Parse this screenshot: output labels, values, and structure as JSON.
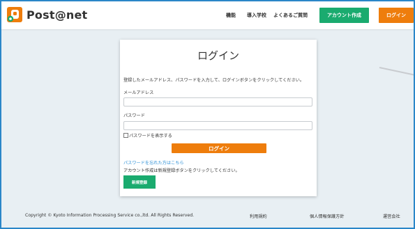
{
  "header": {
    "logo_text": "Post@net",
    "nav": [
      "機能",
      "導入学校",
      "よくあるご質問"
    ],
    "create_account_label": "アカウント作成",
    "login_label": "ログイン"
  },
  "card": {
    "title": "ログイン",
    "intro": "登録したメールアドレス、パスワードを入力して、ログインボタンをクリックしてください。",
    "email_label": "メールアドレス",
    "email_value": "",
    "password_label": "パスワード",
    "password_value": "",
    "show_password_label": "パスワードを表示する",
    "login_button": "ログイン",
    "forgot_link": "パスワードを忘れた方はこちら",
    "register_note": "アカウント作成は新規登録ボタンをクリックしてください。",
    "register_button": "新規登録"
  },
  "footer": {
    "copyright": "Copyright © Kyoto Information Processing Service co.,ltd. All Rights Reserved.",
    "links": [
      "利用規約",
      "個人情報保護方針",
      "運営会社"
    ]
  },
  "colors": {
    "brand_orange": "#ee7d0c",
    "brand_green": "#1aab6f",
    "link_blue": "#2b8fd6",
    "frame_border": "#2a86c8"
  }
}
